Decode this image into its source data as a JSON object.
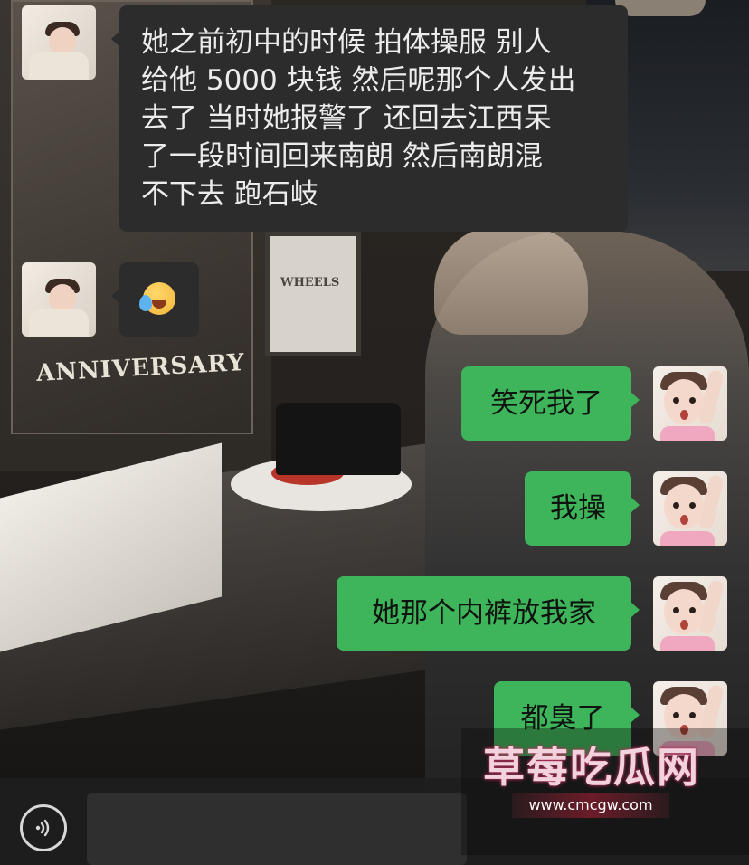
{
  "messages": [
    {
      "side": "in",
      "text": "她之前初中的时候 拍体操服 别人\n给他 5000 块钱 然后呢那个人发出\n去了 当时她报警了 还回去江西呆\n了一段时间回来南朗 然后南朗混\n不下去 跑石岐"
    },
    {
      "side": "in",
      "type": "emoji",
      "emoji": "loudly-crying-face"
    },
    {
      "side": "out",
      "text": "笑死我了"
    },
    {
      "side": "out",
      "text": "我操"
    },
    {
      "side": "out",
      "text": "她那个内裤放我家"
    },
    {
      "side": "out",
      "text": "都臭了"
    }
  ],
  "background": {
    "poster_text": "ANNIVERSARY",
    "frame_text": "WHEELS"
  },
  "input_bar": {
    "voice_icon": "voice-icon",
    "input_value": ""
  },
  "watermark": {
    "title": "草莓吃瓜网",
    "url": "www.cmcgw.com"
  },
  "colors": {
    "outgoing_bubble": "#3eb55a",
    "incoming_bubble": "#2c2c2c"
  }
}
